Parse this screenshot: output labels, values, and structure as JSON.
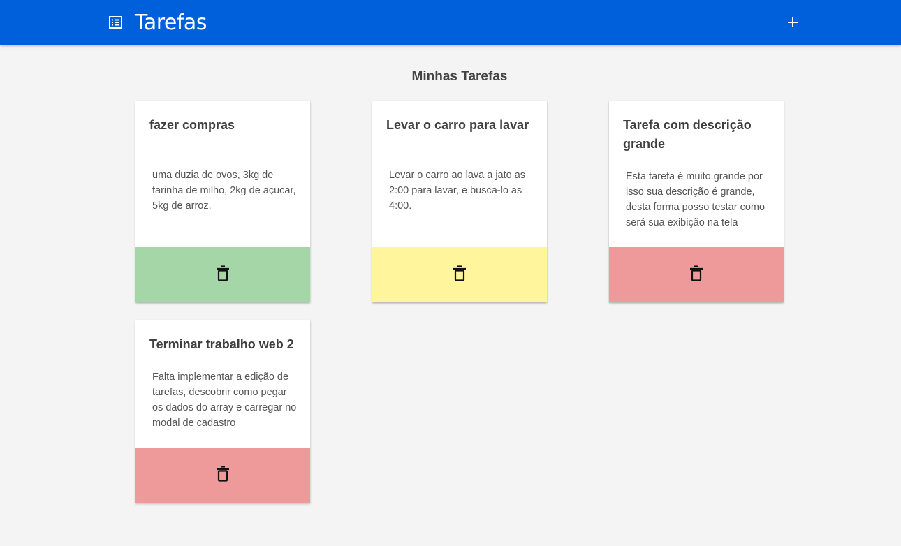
{
  "app": {
    "title": "Tarefas",
    "brand_icon": "list-icon",
    "add_icon": "plus-icon",
    "nav_color": "#0060dc"
  },
  "main": {
    "heading": "Minhas Tarefas"
  },
  "tasks": [
    {
      "title": "fazer compras",
      "description": "uma duzia de ovos, 3kg de farinha de milho, 2kg de açucar, 5kg de arroz.",
      "status_color": "#a5d6a7",
      "delete_icon": "trash-icon"
    },
    {
      "title": "Levar o carro para lavar",
      "description": "Levar o carro ao lava a jato as 2:00 para lavar, e busca-lo as 4:00.",
      "status_color": "#fff59d",
      "delete_icon": "trash-icon"
    },
    {
      "title": "Tarefa com descrição grande",
      "description": "Esta tarefa é muito grande por isso sua descrição é grande, desta forma posso testar como será sua exibição na tela",
      "status_color": "#ef9a9a",
      "delete_icon": "trash-icon"
    },
    {
      "title": "Terminar trabalho web 2",
      "description": "Falta implementar a edição de tarefas, descobrir como pegar os dados do array e carregar no modal de cadastro",
      "status_color": "#ef9a9a",
      "delete_icon": "trash-icon"
    }
  ]
}
